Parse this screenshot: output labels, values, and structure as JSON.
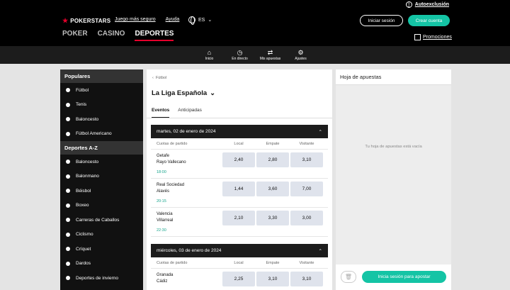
{
  "header": {
    "autoexclusion": "Autoexclusión",
    "brand": "POKERSTARS",
    "links": [
      "Juego más seguro",
      "Ayuda"
    ],
    "language": "ES",
    "login_button": "Iniciar sesión",
    "create_button": "Crear cuenta",
    "nav": [
      "POKER",
      "CASINO",
      "DEPORTES"
    ],
    "promotions": "Promociones"
  },
  "subnav": [
    {
      "label": "Inicio",
      "icon": "home-icon"
    },
    {
      "label": "En directo",
      "icon": "stopwatch-icon"
    },
    {
      "label": "Mis apuestas",
      "icon": "exchange-icon"
    },
    {
      "label": "Ajustes",
      "icon": "gear-icon"
    }
  ],
  "sidebar": {
    "popular_title": "Populares",
    "popular": [
      "Fútbol",
      "Tenis",
      "Baloncesto",
      "Fútbol Americano"
    ],
    "az_title": "Deportes A-Z",
    "az": [
      "Baloncesto",
      "Balonmano",
      "Béisbol",
      "Boxeo",
      "Carreras de Caballos",
      "Ciclismo",
      "Críquet",
      "Dardos",
      "Deportes de invierno"
    ]
  },
  "center": {
    "breadcrumb": "Fútbol",
    "league": "La Liga Española",
    "tabs": [
      "Eventos",
      "Anticipadas"
    ],
    "columns": {
      "market": "Cuotas de partido",
      "home": "Local",
      "draw": "Empate",
      "away": "Visitante"
    },
    "days": [
      {
        "date": "martes, 02 de enero de 2024",
        "matches": [
          {
            "home": "Getafe",
            "away": "Rayo Vallecano",
            "time": "18:00",
            "odds": [
              "2,40",
              "2,80",
              "3,10"
            ]
          },
          {
            "home": "Real Sociedad",
            "away": "Alavés",
            "time": "20:15",
            "odds": [
              "1,44",
              "3,60",
              "7,00"
            ]
          },
          {
            "home": "Valencia",
            "away": "Villarreal",
            "time": "22:30",
            "odds": [
              "2,10",
              "3,30",
              "3,00"
            ]
          }
        ]
      },
      {
        "date": "miércoles, 03 de enero de 2024",
        "matches": [
          {
            "home": "Granada",
            "away": "Cádiz",
            "time": "",
            "odds": [
              "2,25",
              "3,10",
              "3,10"
            ]
          }
        ]
      }
    ]
  },
  "betslip": {
    "title": "Hoja de apuestas",
    "empty": "Tu hoja de apuestas está vacía",
    "login_button": "Inicia sesión para apostar"
  }
}
